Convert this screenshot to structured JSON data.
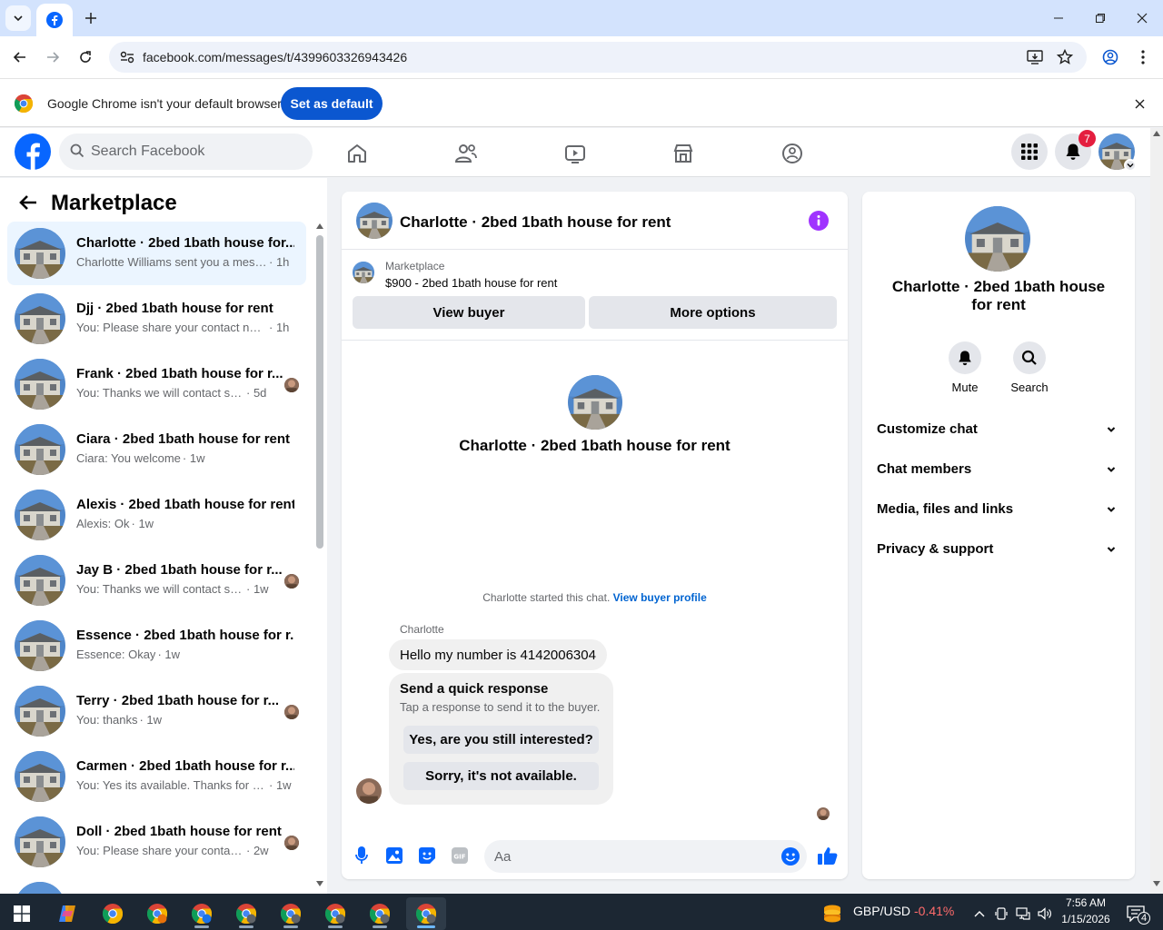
{
  "browser": {
    "url": "facebook.com/messages/t/4399603326943426",
    "infobar_text": "Google Chrome isn't your default browser",
    "set_default_label": "Set as default"
  },
  "fb": {
    "search_placeholder": "Search Facebook",
    "notification_count": "7"
  },
  "sidebar": {
    "title": "Marketplace",
    "chats": [
      {
        "name": "Charlotte · 2bed 1bath house for...",
        "preview": "Charlotte Williams sent you a mess...",
        "time": "· 1h",
        "active": true
      },
      {
        "name": "Djj · 2bed 1bath house for rent",
        "preview": "You: Please share your contact num...",
        "time": "· 1h"
      },
      {
        "name": "Frank · 2bed 1bath house for r...",
        "preview": "You: Thanks we will contact soo...",
        "time": "· 5d"
      },
      {
        "name": "Ciara · 2bed 1bath house for rent",
        "preview": "Ciara: You welcome",
        "time": "· 1w"
      },
      {
        "name": "Alexis · 2bed 1bath house for rent",
        "preview": "Alexis: Ok",
        "time": "· 1w"
      },
      {
        "name": "Jay B · 2bed 1bath house for r...",
        "preview": "You: Thanks we will contact soo...",
        "time": "· 1w"
      },
      {
        "name": "Essence · 2bed 1bath house for r...",
        "preview": "Essence: Okay",
        "time": "· 1w"
      },
      {
        "name": "Terry · 2bed 1bath house for r...",
        "preview": "You: thanks",
        "time": "· 1w"
      },
      {
        "name": "Carmen · 2bed 1bath house for r...",
        "preview": "You: Yes its available. Thanks for re...",
        "time": "· 1w"
      },
      {
        "name": "Doll · 2bed 1bath house for rent",
        "preview": "You: Please share your contact n...",
        "time": "· 2w"
      }
    ]
  },
  "chat": {
    "title": "Charlotte · 2bed 1bath house for rent",
    "listing_source": "Marketplace",
    "listing_title": "$900 - 2bed 1bath house for rent",
    "view_buyer_label": "View buyer",
    "more_options_label": "More options",
    "hero_title": "Charlotte · 2bed 1bath house for rent",
    "started_text": "Charlotte started this chat.",
    "view_profile_link": "View buyer profile",
    "sender_name": "Charlotte",
    "message": "Hello my number is 4142006304",
    "quick_title": "Send a quick response",
    "quick_sub": "Tap a response to send it to the buyer.",
    "quick_reply_1": "Yes, are you still interested?",
    "quick_reply_2": "Sorry, it's not available.",
    "composer_placeholder": "Aa"
  },
  "info_panel": {
    "title": "Charlotte · 2bed 1bath house for rent",
    "mute_label": "Mute",
    "search_label": "Search",
    "sections": [
      "Customize chat",
      "Chat members",
      "Media, files and links",
      "Privacy & support"
    ]
  },
  "taskbar": {
    "ticker_pair": "GBP/USD",
    "ticker_change": "-0.41%",
    "time": "7:56 AM",
    "date": "1/15/2026",
    "notif_count": "4"
  },
  "colors": {
    "fb_blue": "#0866ff",
    "messenger_purple": "#a033ff",
    "chrome_blue": "#0b57d0",
    "notif_red": "#e41e3f",
    "ticker_red": "#ff6b6b"
  }
}
